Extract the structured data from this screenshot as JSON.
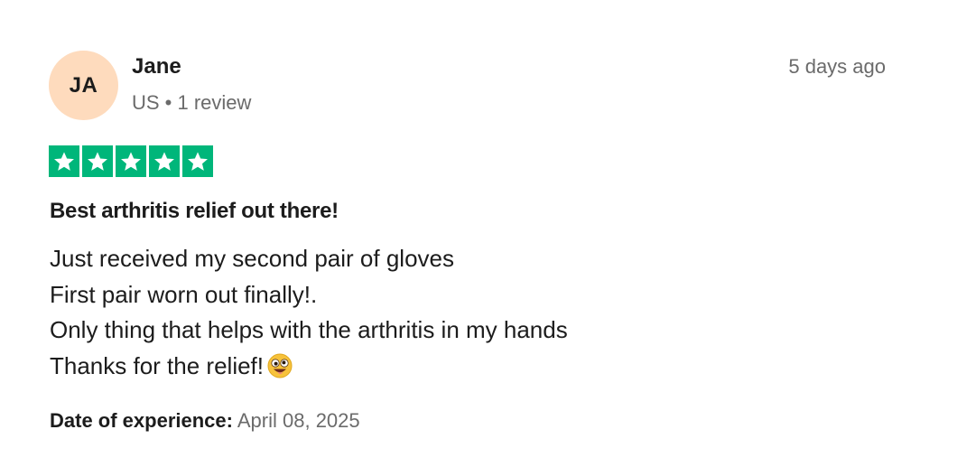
{
  "author": {
    "initials": "JA",
    "name": "Jane",
    "meta": "US • 1 review"
  },
  "timestamp": "5 days ago",
  "rating": {
    "stars": 5,
    "max": 5,
    "color": "#00b67a",
    "icon": "star-icon"
  },
  "review": {
    "title": "Best arthritis relief out there!",
    "lines": [
      "Just received my second pair of gloves",
      "First pair worn out finally!.",
      "Only thing that helps with the arthritis in my hands",
      "Thanks for the relief!"
    ],
    "emoji": "zany-face-icon"
  },
  "experience": {
    "label": "Date of experience:",
    "date": "April 08, 2025"
  },
  "colors": {
    "avatar_bg": "#fedbbd",
    "text": "#1c1c1c",
    "muted": "#6b6b6b"
  }
}
